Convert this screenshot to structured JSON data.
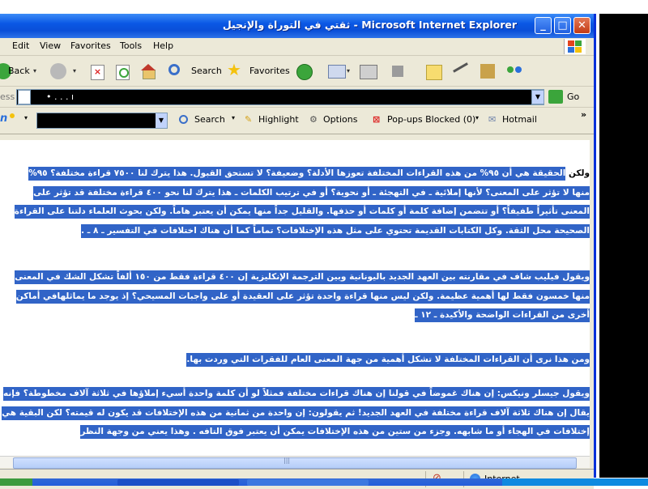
{
  "window": {
    "title": "ثقتي في التوراة والإنجيل - Microsoft Internet Explorer",
    "controls": {
      "minimize": "_",
      "maximize": "□",
      "close": "✕"
    }
  },
  "menu": [
    "Edit",
    "View",
    "Favorites",
    "Tools",
    "Help"
  ],
  "toolbar": {
    "back": "Back",
    "search": "Search",
    "favorites": "Favorites"
  },
  "address": {
    "label": "ess",
    "value": "•   .    .   .   ı",
    "go": "Go"
  },
  "links_bar": {
    "search": "Search",
    "highlight": "Highlight",
    "options": "Options",
    "popups": "Pop-ups Blocked (0)",
    "hotmail": "Hotmail"
  },
  "content": {
    "paragraphs": [
      {
        "lead": "ولكن",
        "text": "الحقيقة هي أن ٩٥% من هذه القراءات المختلفة تعوزها الأدلة؟ وضعيفة؟ لا تستحق القبول. هذا يترك لنا ٧٥٠٠ قراءة مختلفة؟ ٩٥% منها لا تؤثر على المعنى؟ لأنها إملائية ـ في التهجئة ـ أو نحوية؟ أو في ترتيب الكلمات ـ هذا يترك لنا نحو ٤٠٠ قراءة مختلفة قد تؤثر على المعنى تأثيراً طفيفاً؟ أو تتضمن إضافة كلمة أو كلمات أو حذفها. والقليل جداً منها يمكن أن يعتبر هاماً. ولكن بحوث العلماء دلتنا على القراءة الصحيحة محل الثقة. وكل الكتابات القديمة تحتوي على مثل هذه الإختلافات؟ تماماً كما أن هناك اختلافات في التفسير ـ ٨ ـ ."
      },
      {
        "lead": "",
        "text": "ويقول فيليب شاف في مقارنته بين العهد الجديد باليونانية وبين الترجمة الإنكليزية إن ٤٠٠ قراءة فقط من ١٥٠ ألفاً تشكل الشك في المعنى منها خمسون فقط لها أهمية عظيمة. ولكن ليس منها قراءة واحدة تؤثر على العقيدة أو على واجبات المسيحي؟ إذ يوجد ما يماثلهافي أماكن أخرى من القراءات الواضحة والأكيدة ـ ١٢ ـ"
      },
      {
        "lead": "",
        "text": "ومن هذا نرى أن القراءات المختلفة لا تشكل أهمية من جهة المعنى العام للفقرات التي وردت بها."
      },
      {
        "lead": "",
        "text": "ويقول جيسلر ونيكس: إن هناك غموضاً في قولنا إن هناك قراءات مختلفة فمثلاً لو أن كلمة واحدة أُسيء إملاؤها في ثلاثة آلاف مخطوطة؟ فإنه يقال إن هناك ثلاثة آلاف قراءة مختلفة في العهد الجديد! ثم يقولون: إن واحدة من ثمانية من هذه الإختلافات قد يكون له قيمته؟ لكن البقية هي إختلافات في الهجاء أو ما شابهه. وجزء من ستين من هذه الإختلافات يمكن أن يعتبر فوق التافه . وهذا يعني من وجهة النظر"
      }
    ]
  },
  "status": {
    "zone": "Internet"
  },
  "colors": {
    "highlight": "#3164C7",
    "titlebar": "#0A58E5",
    "chrome": "#ECE9D8"
  }
}
